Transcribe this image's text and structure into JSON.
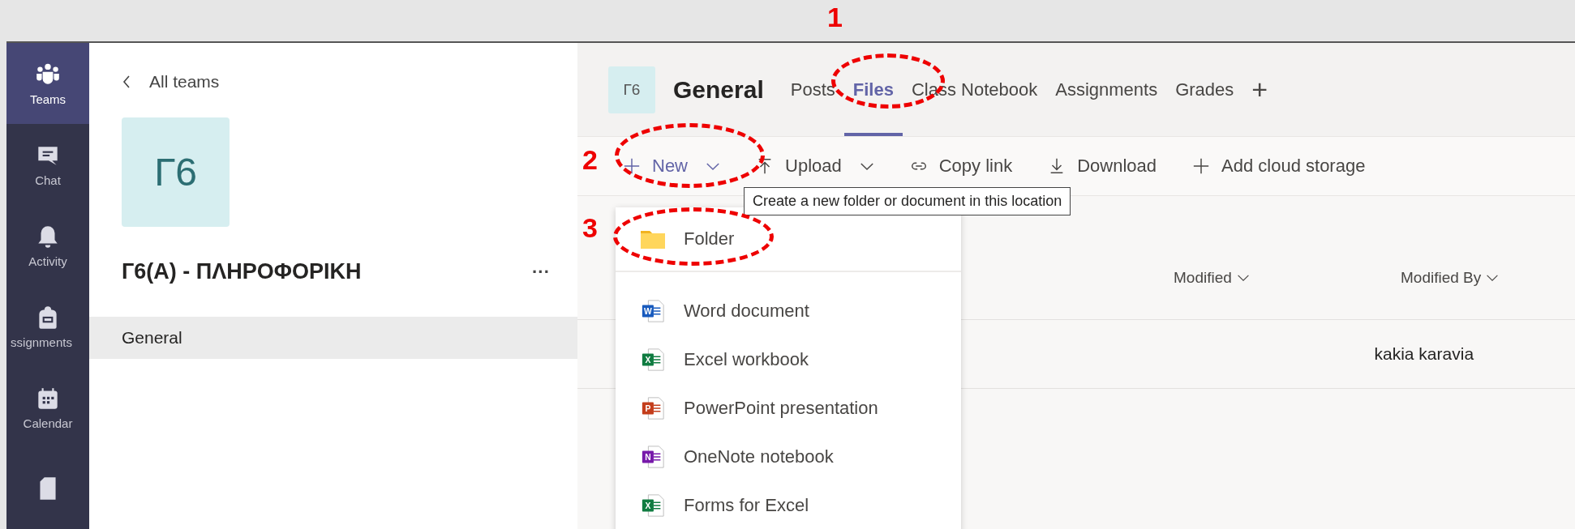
{
  "rail": [
    {
      "kind": "teams",
      "label": "Teams",
      "selected": true
    },
    {
      "kind": "chat",
      "label": "Chat",
      "selected": false
    },
    {
      "kind": "activity",
      "label": "Activity",
      "selected": false
    },
    {
      "kind": "assignments",
      "label": "ssignments",
      "selected": false
    },
    {
      "kind": "calendar",
      "label": "Calendar",
      "selected": false
    },
    {
      "kind": "files",
      "selected": false
    }
  ],
  "sidebar": {
    "back": "All teams",
    "team_tile": "Г6",
    "team_name": "Г6(Α) - ΠΛΗΡΟΦΟΡΙΚΗ",
    "more": "···",
    "channels": [
      {
        "label": "General",
        "selected": true
      }
    ]
  },
  "header": {
    "tile": "Г6",
    "title": "General",
    "tabs": [
      {
        "label": "Posts",
        "selected": false
      },
      {
        "label": "Files",
        "selected": true
      },
      {
        "label": "Class Notebook",
        "selected": false
      },
      {
        "label": "Assignments",
        "selected": false
      },
      {
        "label": "Grades",
        "selected": false
      }
    ],
    "add": "+"
  },
  "toolbar": [
    {
      "kind": "new",
      "label": "New",
      "dropdown": true
    },
    {
      "kind": "upload",
      "label": "Upload",
      "dropdown": true
    },
    {
      "kind": "link",
      "label": "Copy link",
      "dropdown": false
    },
    {
      "kind": "download",
      "label": "Download",
      "dropdown": false
    },
    {
      "kind": "add",
      "label": "Add cloud storage",
      "dropdown": false
    }
  ],
  "tooltip": "Create a new folder or document in this location",
  "menu": [
    {
      "kind": "folder",
      "label": "Folder"
    },
    {
      "kind": "word",
      "icon_letter": "W",
      "label": "Word document"
    },
    {
      "kind": "excel",
      "icon_letter": "X",
      "label": "Excel workbook"
    },
    {
      "kind": "powerpoint",
      "icon_letter": "P",
      "label": "PowerPoint presentation"
    },
    {
      "kind": "onenote",
      "icon_letter": "N",
      "label": "OneNote notebook"
    },
    {
      "kind": "excel",
      "icon_letter": "X",
      "label": "Forms for Excel"
    }
  ],
  "table": {
    "columns": [
      "Modified",
      "Modified By"
    ],
    "rows": [
      [
        "",
        "kakia karavia"
      ]
    ]
  },
  "annotations": [
    {
      "label": "1"
    },
    {
      "label": "2"
    },
    {
      "label": "3"
    }
  ]
}
